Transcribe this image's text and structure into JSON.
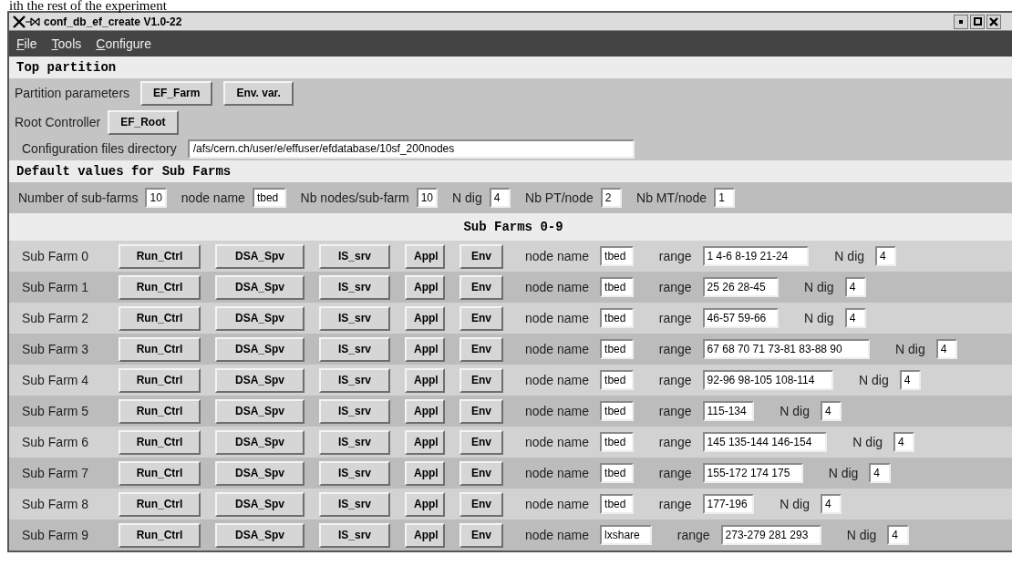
{
  "document_text": "ith the rest of the experiment",
  "window": {
    "title": "conf_db_ef_create V1.0-22"
  },
  "menu": [
    "File",
    "Tools",
    "Configure"
  ],
  "top_partition": {
    "title": "Top partition",
    "partition_parameters": {
      "label": "Partition parameters",
      "buttons": [
        "EF_Farm",
        "Env. var."
      ]
    },
    "root_controller": {
      "label": "Root Controller",
      "buttons": [
        "EF_Root"
      ]
    },
    "config_dir": {
      "label": "Configuration files directory",
      "value": "/afs/cern.ch/user/e/effuser/efdatabase/10sf_200nodes"
    }
  },
  "defaults": {
    "title": "Default values for Sub Farms",
    "fields": [
      {
        "label": "Number of sub-farms",
        "value": "10"
      },
      {
        "label": "node name",
        "value": "tbed"
      },
      {
        "label": "Nb nodes/sub-farm",
        "value": "10"
      },
      {
        "label": "N dig",
        "value": "4"
      },
      {
        "label": "Nb PT/node",
        "value": "2"
      },
      {
        "label": "Nb MT/node",
        "value": "1"
      }
    ]
  },
  "sub_farms": {
    "title": "Sub Farms 0-9",
    "rows": [
      {
        "name": "Sub Farm 0",
        "buttons": [
          "Run_Ctrl",
          "DSA_Spv",
          "IS_srv",
          "Appl",
          "Env"
        ],
        "node_label": "node name",
        "node_name": "tbed",
        "range_label": "range",
        "range": "1 4-6 8-19 21-24",
        "ndig_label": "N dig",
        "ndig": "4"
      },
      {
        "name": "Sub Farm 1",
        "buttons": [
          "Run_Ctrl",
          "DSA_Spv",
          "IS_srv",
          "Appl",
          "Env"
        ],
        "node_label": "node name",
        "node_name": "tbed",
        "range_label": "range",
        "range": "25 26 28-45",
        "ndig_label": "N dig",
        "ndig": "4"
      },
      {
        "name": "Sub Farm 2",
        "buttons": [
          "Run_Ctrl",
          "DSA_Spv",
          "IS_srv",
          "Appl",
          "Env"
        ],
        "node_label": "node name",
        "node_name": "tbed",
        "range_label": "range",
        "range": "46-57 59-66",
        "ndig_label": "N dig",
        "ndig": "4"
      },
      {
        "name": "Sub Farm 3",
        "buttons": [
          "Run_Ctrl",
          "DSA_Spv",
          "IS_srv",
          "Appl",
          "Env"
        ],
        "node_label": "node name",
        "node_name": "tbed",
        "range_label": "range",
        "range": "67 68 70 71 73-81 83-88 90",
        "ndig_label": "N dig",
        "ndig": "4"
      },
      {
        "name": "Sub Farm 4",
        "buttons": [
          "Run_Ctrl",
          "DSA_Spv",
          "IS_srv",
          "Appl",
          "Env"
        ],
        "node_label": "node name",
        "node_name": "tbed",
        "range_label": "range",
        "range": "92-96 98-105 108-114",
        "ndig_label": "N dig",
        "ndig": "4"
      },
      {
        "name": "Sub Farm 5",
        "buttons": [
          "Run_Ctrl",
          "DSA_Spv",
          "IS_srv",
          "Appl",
          "Env"
        ],
        "node_label": "node name",
        "node_name": "tbed",
        "range_label": "range",
        "range": "115-134",
        "ndig_label": "N dig",
        "ndig": "4"
      },
      {
        "name": "Sub Farm 6",
        "buttons": [
          "Run_Ctrl",
          "DSA_Spv",
          "IS_srv",
          "Appl",
          "Env"
        ],
        "node_label": "node name",
        "node_name": "tbed",
        "range_label": "range",
        "range": "145 135-144 146-154",
        "ndig_label": "N dig",
        "ndig": "4"
      },
      {
        "name": "Sub Farm 7",
        "buttons": [
          "Run_Ctrl",
          "DSA_Spv",
          "IS_srv",
          "Appl",
          "Env"
        ],
        "node_label": "node name",
        "node_name": "tbed",
        "range_label": "range",
        "range": "155-172 174 175",
        "ndig_label": "N dig",
        "ndig": "4"
      },
      {
        "name": "Sub Farm 8",
        "buttons": [
          "Run_Ctrl",
          "DSA_Spv",
          "IS_srv",
          "Appl",
          "Env"
        ],
        "node_label": "node name",
        "node_name": "tbed",
        "range_label": "range",
        "range": "177-196",
        "ndig_label": "N dig",
        "ndig": "4"
      },
      {
        "name": "Sub Farm 9",
        "buttons": [
          "Run_Ctrl",
          "DSA_Spv",
          "IS_srv",
          "Appl",
          "Env"
        ],
        "node_label": "node name",
        "node_name": "lxshare",
        "range_label": "range",
        "range": "273-279 281 293",
        "ndig_label": "N dig",
        "ndig": "4"
      }
    ]
  }
}
